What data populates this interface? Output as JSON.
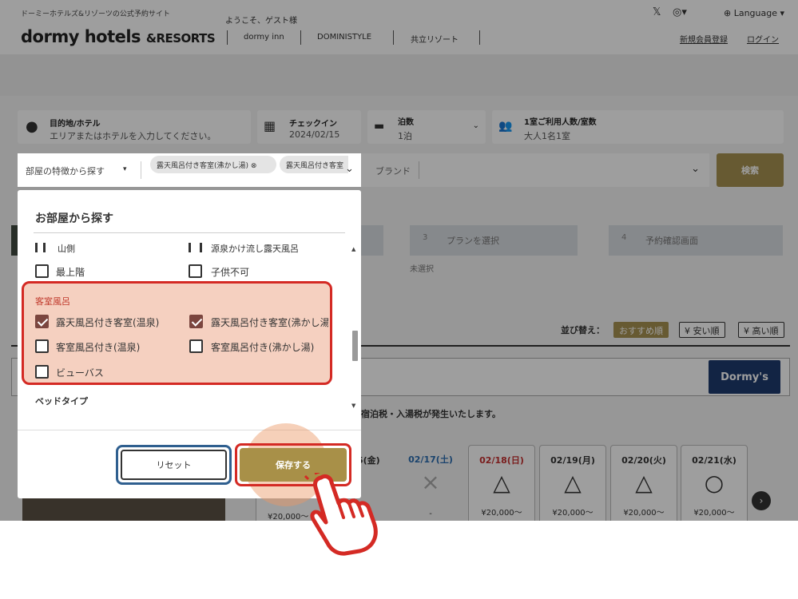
{
  "header": {
    "tagline": "ドーミーホテルズ&リゾーツの公式予約サイト",
    "logo": "dormy hotels",
    "logo_suffix": "&RESORTS",
    "welcome": "ようこそ、ゲスト様",
    "nav": [
      "dormy inn",
      "DOMINISTYLE",
      "共立リゾート"
    ],
    "language": "Language",
    "register": "新規会員登録",
    "login": "ログイン"
  },
  "search": {
    "destination_label": "目的地/ホテル",
    "destination_placeholder": "エリアまたはホテルを入力してください。",
    "checkin_label": "チェックイン",
    "checkin_value": "2024/02/15",
    "nights_label": "泊数",
    "nights_value": "1泊",
    "guests_label": "1室ご利用人数/室数",
    "guests_value": "大人1名1室",
    "feature_placeholder": "部屋の特徴から探す",
    "chips": [
      "露天風呂付き客室(沸かし湯)",
      "露天風呂付き客室"
    ],
    "brand_placeholder": "ブランド",
    "search_button": "検索"
  },
  "steps": [
    {
      "num": "3",
      "label": "プランを選択",
      "sub": "未選択"
    },
    {
      "num": "4",
      "label": "予約確認画面",
      "sub": ""
    }
  ],
  "sort": {
    "label": "並び替え：",
    "options": [
      "おすすめ順",
      "¥ 安い順",
      "¥ 高い順"
    ]
  },
  "brand_logo": "Dormy's",
  "tax_note": "宿泊税・入湯税が発生いたします。",
  "dates": [
    {
      "date": "02/17(土)",
      "mark": "×",
      "price": "-",
      "color": "#2b6cb0"
    },
    {
      "date": "02/18(日)",
      "mark": "△",
      "price": "¥20,000〜",
      "color": "#c53030"
    },
    {
      "date": "02/19(月)",
      "mark": "△",
      "price": "¥20,000〜",
      "color": "#333333"
    },
    {
      "date": "02/20(火)",
      "mark": "△",
      "price": "¥20,000〜",
      "color": "#333333"
    },
    {
      "date": "02/21(水)",
      "mark": "○",
      "price": "¥20,000〜",
      "color": "#333333"
    }
  ],
  "partial_date": "5(金)",
  "partial_price": "¥20,000〜",
  "modal": {
    "title": "お部屋から探す",
    "row_top": [
      "山側",
      "源泉かけ流し露天風呂"
    ],
    "row1": [
      {
        "label": "最上階",
        "checked": false
      },
      {
        "label": "子供不可",
        "checked": false
      }
    ],
    "section_bath": "客室風呂",
    "bath_options": [
      {
        "label": "露天風呂付き客室(温泉)",
        "checked": true
      },
      {
        "label": "露天風呂付き客室(沸かし湯)",
        "checked": true
      },
      {
        "label": "客室風呂付き(温泉)",
        "checked": false
      },
      {
        "label": "客室風呂付き(沸かし湯)",
        "checked": false
      },
      {
        "label": "ビューバス",
        "checked": false
      }
    ],
    "section_bed": "ベッドタイプ",
    "reset_button": "リセット",
    "save_button": "保存する"
  },
  "colors": {
    "accent_gold": "#a69152",
    "highlight_red": "#d42a24",
    "checkbox_checked": "#7b463f",
    "reset_border_blue": "#2f5f8f"
  }
}
